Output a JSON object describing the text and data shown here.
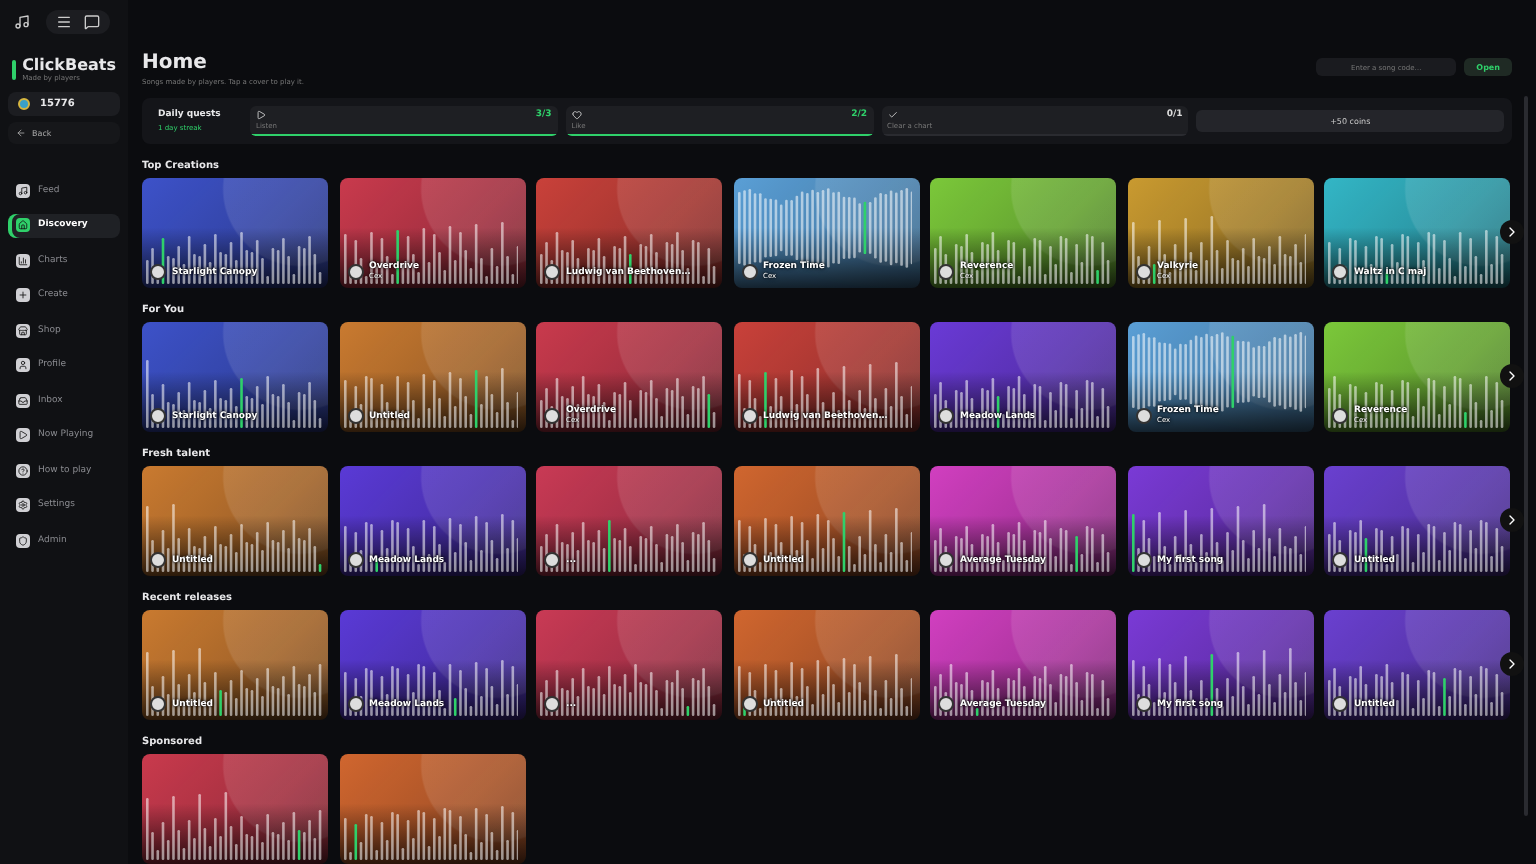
{
  "brand": {
    "name": "ClickBeats",
    "tagline": "Made by players"
  },
  "coins": "15776",
  "back": "Back",
  "nav": [
    {
      "label": "Feed",
      "selected": false
    },
    {
      "label": "Discovery",
      "selected": true
    },
    {
      "label": "Charts",
      "selected": false
    },
    {
      "label": "Create",
      "selected": false
    },
    {
      "label": "Shop",
      "selected": false
    },
    {
      "label": "Profile",
      "selected": false
    },
    {
      "label": "Inbox",
      "selected": false
    },
    {
      "label": "Now Playing",
      "selected": false
    },
    {
      "label": "How to play",
      "selected": false
    },
    {
      "label": "Settings",
      "selected": false
    },
    {
      "label": "Admin",
      "selected": false
    }
  ],
  "page": {
    "title": "Home",
    "subtitle": "Songs made by players. Tap a cover to play it."
  },
  "song_code": {
    "placeholder": "Enter a song code…",
    "button": "Open"
  },
  "quests": {
    "title": "Daily quests",
    "streak": "1 day streak",
    "reward": "+50 coins",
    "items": [
      {
        "label": "Listen",
        "count": "3/3",
        "level": 1
      },
      {
        "label": "Like",
        "count": "2/2",
        "level": 1
      },
      {
        "label": "Clear a chart",
        "count": "0/1",
        "level": 0
      }
    ]
  },
  "sections": [
    {
      "title": "Top Creations",
      "more": true,
      "cards": [
        {
          "title": "Starlight Canopy",
          "color": "#3d52c9",
          "kind": "bars"
        },
        {
          "title": "Overdrive",
          "author": "Cex",
          "color": "#c93a4d",
          "kind": "bars"
        },
        {
          "title": "Ludwig van Beethoven…",
          "color": "#c9413a",
          "kind": "bars"
        },
        {
          "title": "Frozen Time",
          "author": "Cex",
          "color": "#5a9fd6",
          "kind": "wave"
        },
        {
          "title": "Reverence",
          "author": "Cex",
          "color": "#7bc83a",
          "kind": "bars"
        },
        {
          "title": "Valkyrie",
          "author": "Cex",
          "color": "#c99a30",
          "kind": "bars"
        },
        {
          "title": "Waltz in C maj",
          "color": "#33b6c6",
          "kind": "bars"
        }
      ]
    },
    {
      "title": "For You",
      "more": true,
      "cards": [
        {
          "title": "Starlight Canopy",
          "color": "#3d52c9",
          "kind": "bars"
        },
        {
          "title": "Untitled",
          "color": "#c97a30",
          "kind": "bars"
        },
        {
          "title": "Overdrive",
          "author": "Cex",
          "color": "#c93a4d",
          "kind": "bars"
        },
        {
          "title": "Ludwig van Beethoven…",
          "color": "#c9413a",
          "kind": "bars"
        },
        {
          "title": "Meadow Lands",
          "color": "#6a3ad6",
          "kind": "bars"
        },
        {
          "title": "Frozen Time",
          "author": "Cex",
          "color": "#5a9fd6",
          "kind": "wave"
        },
        {
          "title": "Reverence",
          "author": "Cex",
          "color": "#7bc83a",
          "kind": "bars"
        }
      ]
    },
    {
      "title": "Fresh talent",
      "more": true,
      "cards": [
        {
          "title": "Untitled",
          "color": "#c97a30",
          "kind": "bars"
        },
        {
          "title": "Meadow Lands",
          "color": "#5a3ad6",
          "kind": "bars"
        },
        {
          "title": "...",
          "color": "#c93a55",
          "kind": "bars"
        },
        {
          "title": "Untitled",
          "color": "#d0662f",
          "kind": "bars"
        },
        {
          "title": "Average Tuesday",
          "color": "#d13fc0",
          "kind": "bars"
        },
        {
          "title": "My first song",
          "color": "#7a3ad6",
          "kind": "bars"
        },
        {
          "title": "Untitled",
          "color": "#6a40d0",
          "kind": "bars"
        }
      ]
    },
    {
      "title": "Recent releases",
      "more": true,
      "cards": [
        {
          "title": "Untitled",
          "color": "#c97a30",
          "kind": "bars"
        },
        {
          "title": "Meadow Lands",
          "color": "#5a3ad6",
          "kind": "bars"
        },
        {
          "title": "...",
          "color": "#c93a55",
          "kind": "bars"
        },
        {
          "title": "Untitled",
          "color": "#d0662f",
          "kind": "bars"
        },
        {
          "title": "Average Tuesday",
          "color": "#d13fc0",
          "kind": "bars"
        },
        {
          "title": "My first song",
          "color": "#7a3ad6",
          "kind": "bars"
        },
        {
          "title": "Untitled",
          "color": "#6a40d0",
          "kind": "bars"
        }
      ]
    },
    {
      "title": "Sponsored",
      "more": false,
      "cards": [
        {
          "color": "#c93a4d",
          "kind": "bars"
        },
        {
          "color": "#d0662f",
          "kind": "bars"
        }
      ]
    }
  ]
}
